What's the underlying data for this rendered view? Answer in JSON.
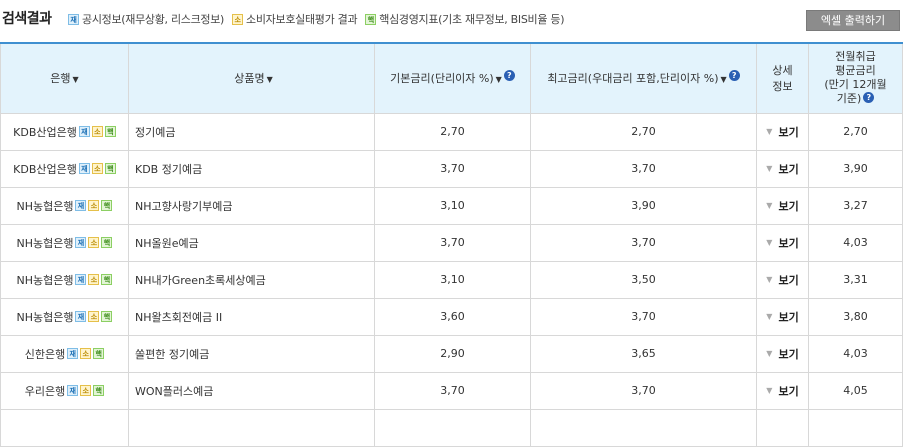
{
  "header": {
    "title": "검색결과",
    "legend": [
      {
        "badge": "재",
        "label": "공시정보(재무상황, 리스크정보)"
      },
      {
        "badge": "소",
        "label": "소비자보호실태평가 결과"
      },
      {
        "badge": "핵",
        "label": "핵심경영지표(기초 재무정보, BIS비율 등)"
      }
    ],
    "excel_button": "엑셀 출력하기"
  },
  "columns": {
    "bank": "은행",
    "product": "상품명",
    "base_rate": "기본금리(단리이자 %)",
    "max_rate": "최고금리(우대금리 포함,단리이자 %)",
    "detail_line1": "상세",
    "detail_line2": "정보",
    "avg_line1": "전월취급",
    "avg_line2": "평균금리",
    "avg_line3": "(만기 12개월",
    "avg_line4": "기준)"
  },
  "badges": {
    "jae": "재",
    "so": "소",
    "hyeok": "핵"
  },
  "detail_label": "보기",
  "rows": [
    {
      "bank": "KDB산업은행",
      "product": "정기예금",
      "base": "2,70",
      "max": "2,70",
      "avg": "2,70"
    },
    {
      "bank": "KDB산업은행",
      "product": "KDB 정기예금",
      "base": "3,70",
      "max": "3,70",
      "avg": "3,90"
    },
    {
      "bank": "NH농협은행",
      "product": "NH고향사랑기부예금",
      "base": "3,10",
      "max": "3,90",
      "avg": "3,27"
    },
    {
      "bank": "NH농협은행",
      "product": "NH올원e예금",
      "base": "3,70",
      "max": "3,70",
      "avg": "4,03"
    },
    {
      "bank": "NH농협은행",
      "product": "NH내가Green초록세상예금",
      "base": "3,10",
      "max": "3,50",
      "avg": "3,31"
    },
    {
      "bank": "NH농협은행",
      "product": "NH왈츠회전예금 II",
      "base": "3,60",
      "max": "3,70",
      "avg": "3,80"
    },
    {
      "bank": "신한은행",
      "product": "쏠편한 정기예금",
      "base": "2,90",
      "max": "3,65",
      "avg": "4,03"
    },
    {
      "bank": "우리은행",
      "product": "WON플러스예금",
      "base": "3,70",
      "max": "3,70",
      "avg": "4,05"
    },
    {
      "bank": "",
      "product": "",
      "base": "",
      "max": "",
      "avg": ""
    }
  ]
}
